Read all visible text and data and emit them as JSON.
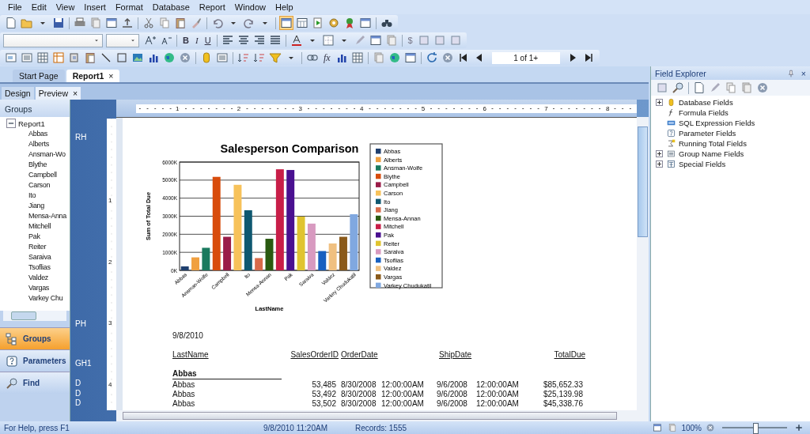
{
  "menu": [
    "File",
    "Edit",
    "View",
    "Insert",
    "Format",
    "Database",
    "Report",
    "Window",
    "Help"
  ],
  "format_toolbar": {
    "style_buttons": [
      "B",
      "I",
      "U"
    ],
    "number_buttons": [
      "$"
    ]
  },
  "insert_toolbar": {
    "formula_button": "fx",
    "page_field": "1 of 1+"
  },
  "doc_tabs": [
    {
      "label": "Start Page",
      "selected": false
    },
    {
      "label": "Report1",
      "selected": true,
      "close": "×"
    }
  ],
  "view_tabs": [
    {
      "label": "Design",
      "selected": false
    },
    {
      "label": "Preview",
      "selected": true,
      "close": "×"
    }
  ],
  "groups_panel": {
    "title": "Groups",
    "tree": [
      {
        "label": "Report1",
        "expanded": true,
        "children": [
          {
            "label": "Abbas"
          },
          {
            "label": "Alberts"
          },
          {
            "label": "Ansman-Wo"
          },
          {
            "label": "Blythe"
          },
          {
            "label": "Campbell"
          },
          {
            "label": "Carson"
          },
          {
            "label": "Ito"
          },
          {
            "label": "Jiang"
          },
          {
            "label": "Mensa-Anna"
          },
          {
            "label": "Mitchell"
          },
          {
            "label": "Pak"
          },
          {
            "label": "Reiter"
          },
          {
            "label": "Saraiva"
          },
          {
            "label": "Tsoflias"
          },
          {
            "label": "Valdez"
          },
          {
            "label": "Vargas"
          },
          {
            "label": "Varkey Chu"
          }
        ]
      }
    ]
  },
  "nav_buttons": [
    {
      "label": "Groups",
      "kind": "groups",
      "selected": true
    },
    {
      "label": "Parameters",
      "kind": "parameters",
      "selected": false
    },
    {
      "label": "Find",
      "kind": "find",
      "selected": false
    }
  ],
  "sections": [
    {
      "label": "RH",
      "kind": "report_header"
    },
    {
      "label": "PH",
      "kind": "page_header"
    },
    {
      "label": "GH1",
      "kind": "group_header"
    },
    {
      "label": "D",
      "kind": "details"
    },
    {
      "label": "D",
      "kind": "details"
    },
    {
      "label": "D",
      "kind": "details"
    }
  ],
  "h_ruler": [
    "1",
    "2",
    "3",
    "4",
    "5",
    "6",
    "7",
    "8"
  ],
  "v_ruler": [
    "1",
    "2",
    "3",
    "4"
  ],
  "report": {
    "chart_data": {
      "type": "bar",
      "title": "Salesperson Comparison",
      "xlabel": "LastName",
      "ylabel": "Sum of Total Due",
      "categories": [
        "Abbas",
        null,
        "Ansman-Wolfe",
        null,
        "Campbell",
        null,
        "Ito",
        null,
        "Mensa-Annan",
        null,
        "Pak",
        null,
        "Saraiva",
        null,
        "Valdez",
        null,
        "Varkey Chudukatil"
      ],
      "grid": true,
      "series": [
        {
          "values": [
            220,
            720,
            1250,
            5180,
            1860,
            4740,
            3330,
            680,
            1750,
            5600,
            5560,
            2980,
            2590,
            1070,
            1490,
            1860,
            3110
          ]
        }
      ],
      "ylim": [
        0,
        6000
      ],
      "yticks": [
        {
          "value": 0,
          "label": "0K"
        },
        {
          "value": 1000,
          "label": "1000K"
        },
        {
          "value": 2000,
          "label": "2000K"
        },
        {
          "value": 3000,
          "label": "3000K"
        },
        {
          "value": 4000,
          "label": "4000K"
        },
        {
          "value": 5000,
          "label": "5000K"
        },
        {
          "value": 6000,
          "label": "6000K"
        }
      ]
    },
    "legend": [
      {
        "label": "Abbas",
        "color": "#1f3f6e"
      },
      {
        "label": "Alberts",
        "color": "#f0a040"
      },
      {
        "label": "Ansman-Wolfe",
        "color": "#1a7a5e"
      },
      {
        "label": "Blythe",
        "color": "#d84c0c"
      },
      {
        "label": "Campbell",
        "color": "#9a1c48"
      },
      {
        "label": "Carson",
        "color": "#f7c25a"
      },
      {
        "label": "Ito",
        "color": "#0f5870"
      },
      {
        "label": "Jiang",
        "color": "#d86a4a"
      },
      {
        "label": "Mensa-Annan",
        "color": "#2a5a10"
      },
      {
        "label": "Mitchell",
        "color": "#c81e48"
      },
      {
        "label": "Pak",
        "color": "#4a1090"
      },
      {
        "label": "Reiter",
        "color": "#e0c430"
      },
      {
        "label": "Saraiva",
        "color": "#d89ac0"
      },
      {
        "label": "Tsoflias",
        "color": "#1860c0"
      },
      {
        "label": "Valdez",
        "color": "#f0c080"
      },
      {
        "label": "Vargas",
        "color": "#8a5a1a"
      },
      {
        "label": "Varkey Chudukatil",
        "color": "#80a8e0"
      }
    ],
    "print_date": "9/8/2010",
    "columns": [
      "LastName",
      "SalesOrderID",
      "OrderDate",
      "ShipDate",
      "TotalDue"
    ],
    "group": "Abbas",
    "rows": [
      {
        "last_name": "Abbas",
        "order_id": "53,485",
        "order_date": "8/30/2008",
        "order_time": "12:00:00AM",
        "ship_date": "9/6/2008",
        "ship_time": "12:00:00AM",
        "total_due": "$85,652.33"
      },
      {
        "last_name": "Abbas",
        "order_id": "53,492",
        "order_date": "8/30/2008",
        "order_time": "12:00:00AM",
        "ship_date": "9/6/2008",
        "ship_time": "12:00:00AM",
        "total_due": "$25,139.98"
      },
      {
        "last_name": "Abbas",
        "order_id": "53,502",
        "order_date": "8/30/2008",
        "order_time": "12:00:00AM",
        "ship_date": "9/6/2008",
        "ship_time": "12:00:00AM",
        "total_due": "$45,338.76"
      }
    ]
  },
  "field_explorer": {
    "title": "Field Explorer",
    "close": "×",
    "items": [
      {
        "label": "Database Fields",
        "kind": "database",
        "expandable": true
      },
      {
        "label": "Formula Fields",
        "kind": "formula",
        "expandable": false
      },
      {
        "label": "SQL Expression Fields",
        "kind": "sql",
        "expandable": false
      },
      {
        "label": "Parameter Fields",
        "kind": "parameter",
        "expandable": false
      },
      {
        "label": "Running Total Fields",
        "kind": "running_total",
        "expandable": false
      },
      {
        "label": "Group Name Fields",
        "kind": "group_name",
        "expandable": true
      },
      {
        "label": "Special Fields",
        "kind": "special",
        "expandable": true
      }
    ]
  },
  "status_bar": {
    "help": "For Help, press F1",
    "datetime": "9/8/2010  11:20AM",
    "records": "Records:  1555",
    "zoom": "100%",
    "zoom_level": {
      "level": 0.5
    }
  }
}
